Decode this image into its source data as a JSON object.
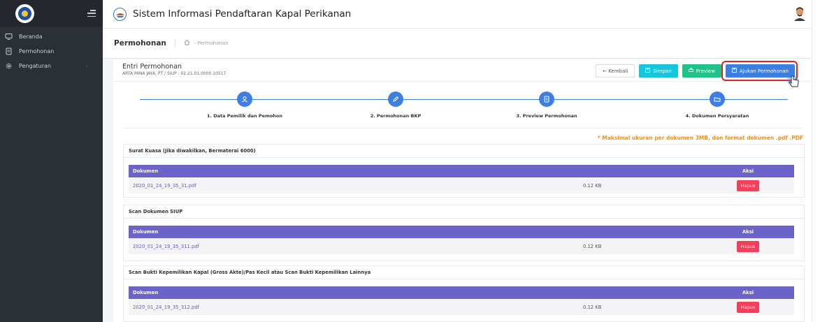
{
  "sidebar": {
    "items": [
      {
        "label": "Beranda",
        "icon": "monitor-icon"
      },
      {
        "label": "Permohonan",
        "icon": "document-icon"
      },
      {
        "label": "Pengaturan",
        "icon": "gear-icon"
      }
    ]
  },
  "header": {
    "title": "Sistem Informasi Pendaftaran Kapal Perikanan"
  },
  "breadcrumb": {
    "title": "Permohonan",
    "current": "- Permohonan"
  },
  "entri": {
    "title": "Entri Permohonan",
    "subtitle": "ARTA MINA JAYA, PT / SIUP : 02.21.01.0000.10517"
  },
  "buttons": {
    "kembali": "← Kembali",
    "simpan": "Simpan",
    "preview": "Preview",
    "ajukan": "Ajukan Permohonan"
  },
  "steps": [
    {
      "label": "1. Data Pemilik dan Pemohon"
    },
    {
      "label": "2. Permohonan BKP"
    },
    {
      "label": "3. Preview Permohonan"
    },
    {
      "label": "4. Dokumen Persyaratan"
    }
  ],
  "note": "* Maksimal ukuran per dokumen 3MB, dan format dokumen .pdf .PDF",
  "table_headers": {
    "dokumen": "Dokumen",
    "aksi": "Aksi"
  },
  "sections": [
    {
      "title": "Surat Kuasa (Jika diwakilkan, Bermaterai 6000)",
      "file": "2020_01_24_19_35_31.pdf",
      "size": "0.12 KB",
      "action": "Hapus"
    },
    {
      "title": "Scan Dokumen SIUP",
      "file": "2020_01_24_19_35_311.pdf",
      "size": "0.12 KB",
      "action": "Hapus"
    },
    {
      "title": "Scan Bukti Kepemilikan Kapal (Gross Akte)/Pas Kecil atau Scan Bukti Kepemilikan Lainnya",
      "file": "2020_01_24_19_35_312.pdf",
      "size": "0.12 KB",
      "action": "Hapus"
    }
  ],
  "colors": {
    "sidebar": "#2b2f36",
    "primary": "#3d7fe0",
    "table_header": "#6c63c9",
    "danger": "#f2405a",
    "note": "#f0921c"
  }
}
